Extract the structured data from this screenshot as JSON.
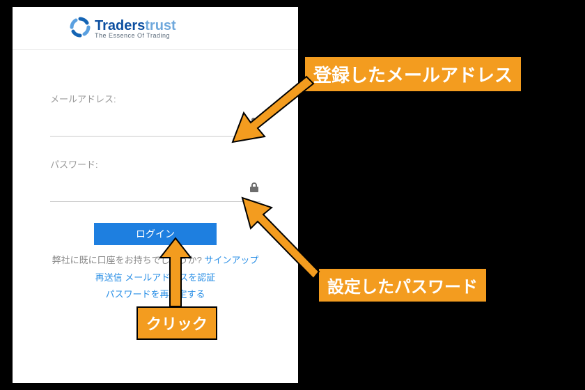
{
  "logo": {
    "brand1": "Traders",
    "brand2": "trust",
    "tagline": "The Essence Of Trading"
  },
  "form": {
    "email_label": "メールアドレス:",
    "password_label": "パスワード:",
    "login_button": "ログイン",
    "own_account_text": "弊社に既に口座をお持ちでしょうか? ",
    "signup_link": "サインアップ",
    "resend_prefix": "再送信 ",
    "resend_link": "メールアドレスを認証",
    "reset_link": "パスワードを再設定する"
  },
  "annotations": {
    "email": "登録したメールアドレス",
    "password": "設定したパスワード",
    "click": "クリック"
  }
}
